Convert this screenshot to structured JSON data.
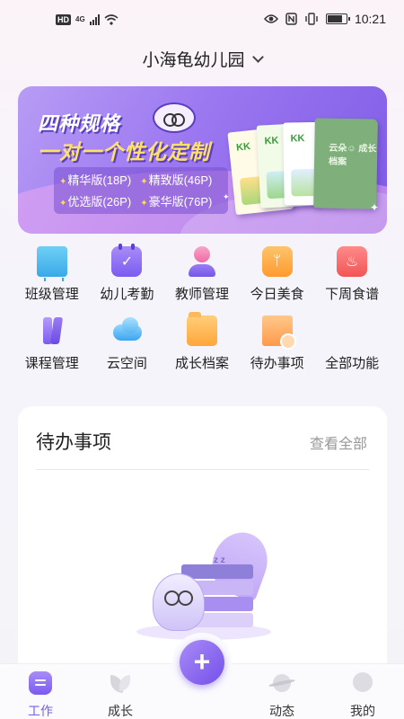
{
  "status_bar": {
    "hd": "HD",
    "network": "4G",
    "time": "10:21"
  },
  "header": {
    "school_name": "小海龟幼儿园"
  },
  "banner": {
    "title_line1": "四种规格",
    "title_line2": "一对一个性化定制",
    "editions": [
      "精华版(18P)",
      "精致版(46P)",
      "优选版(26P)",
      "豪华版(76P)"
    ],
    "book_caps": [
      "KK",
      "KK",
      "KK",
      "云朵☺ 成长档案"
    ]
  },
  "quick_menu": {
    "items": [
      {
        "label": "班级管理",
        "icon": "class-board-icon"
      },
      {
        "label": "幼儿考勤",
        "icon": "attendance-calendar-icon"
      },
      {
        "label": "教师管理",
        "icon": "teacher-icon"
      },
      {
        "label": "今日美食",
        "icon": "fork-spoon-icon"
      },
      {
        "label": "下周食谱",
        "icon": "recipe-book-icon"
      },
      {
        "label": "课程管理",
        "icon": "course-book-icon"
      },
      {
        "label": "云空间",
        "icon": "cloud-icon"
      },
      {
        "label": "成长档案",
        "icon": "folder-icon"
      },
      {
        "label": "待办事项",
        "icon": "todo-bookmark-icon"
      },
      {
        "label": "全部功能",
        "icon": "grid-icon"
      }
    ]
  },
  "todo": {
    "title": "待办事项",
    "more": "查看全部"
  },
  "bottom_nav": {
    "items": [
      {
        "label": "工作",
        "icon": "work-icon",
        "active": true
      },
      {
        "label": "成长",
        "icon": "leaf-icon",
        "active": false
      },
      {
        "label": "动态",
        "icon": "planet-icon",
        "active": false
      },
      {
        "label": "我的",
        "icon": "profile-icon",
        "active": false
      }
    ],
    "fab": "+"
  },
  "colors": {
    "accent": "#7a5cf0",
    "banner_start": "#b79cf5",
    "banner_end": "#7e5be6",
    "edition_star": "#ffd86a"
  }
}
